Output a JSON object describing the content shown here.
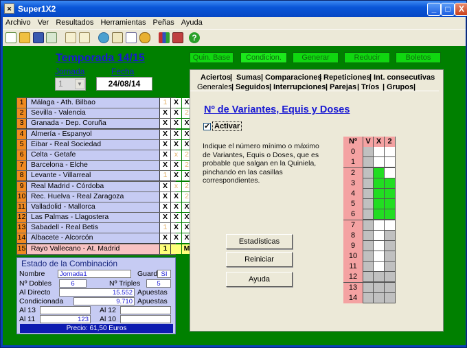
{
  "window": {
    "title": "Super1X2",
    "buttons": [
      "_",
      "□",
      "X"
    ]
  },
  "menu": [
    "Archivo",
    "Ver",
    "Resultados",
    "Herramientas",
    "Peñas",
    "Ayuda"
  ],
  "toolbar": {
    "icons": [
      "new-icon",
      "open-icon",
      "save-icon",
      "export-icon",
      "copy-icon",
      "paste-icon",
      "globe-icon",
      "edit-icon",
      "document-icon",
      "coins-icon",
      "chart-icon",
      "book-icon",
      "help-icon"
    ],
    "help_glyph": "?"
  },
  "season": {
    "title": "Temporada 14/15",
    "jornada_label": "Jornada",
    "jornada_value": "1",
    "fecha_label": "Fecha",
    "fecha_value": "24/08/14"
  },
  "matches": [
    {
      "n": "1",
      "name": "Málaga - Ath. Bilbao",
      "c1": "1",
      "c2": "X",
      "c3": "X"
    },
    {
      "n": "2",
      "name": "Sevilla - Valencia",
      "c1": "X",
      "c2": "X",
      "c3": "2"
    },
    {
      "n": "3",
      "name": "Granada - Dep. Coruña",
      "c1": "X",
      "c2": "X",
      "c3": "X"
    },
    {
      "n": "4",
      "name": "Almería - Espanyol",
      "c1": "X",
      "c2": "X",
      "c3": "X"
    },
    {
      "n": "5",
      "name": "Eibar - Real Sociedad",
      "c1": "X",
      "c2": "X",
      "c3": "X"
    },
    {
      "n": "6",
      "name": "Celta - Getafe",
      "c1": "X",
      "c2": "x",
      "c3": "2"
    },
    {
      "n": "7",
      "name": "Barcelona - Elche",
      "c1": "X",
      "c2": "X",
      "c3": "2"
    },
    {
      "n": "8",
      "name": "Levante - Villarreal",
      "c1": "1",
      "c2": "X",
      "c3": "X"
    },
    {
      "n": "9",
      "name": "Real Madrid - Córdoba",
      "c1": "X",
      "c2": "x",
      "c3": "2"
    },
    {
      "n": "10",
      "name": "Rec. Huelva - Real Zaragoza",
      "c1": "X",
      "c2": "X",
      "c3": "2"
    },
    {
      "n": "11",
      "name": "Valladolid - Mallorca",
      "c1": "X",
      "c2": "X",
      "c3": "X"
    },
    {
      "n": "12",
      "name": "Las Palmas - Llagostera",
      "c1": "X",
      "c2": "X",
      "c3": "X"
    },
    {
      "n": "13",
      "name": "Sabadell - Real Betis",
      "c1": "1",
      "c2": "X",
      "c3": "X"
    },
    {
      "n": "14",
      "name": "Albacete - Alcorcón",
      "c1": "X",
      "c2": "X",
      "c3": "X"
    },
    {
      "n": "15",
      "name": "Rayo Vallecano - At. Madrid",
      "c1": "1",
      "c2": "",
      "c3": "M"
    }
  ],
  "dim_cells": [
    [
      0,
      0
    ],
    [
      1,
      2
    ],
    [
      5,
      1
    ],
    [
      5,
      2
    ],
    [
      6,
      2
    ],
    [
      7,
      0
    ],
    [
      8,
      1
    ],
    [
      8,
      2
    ],
    [
      9,
      2
    ],
    [
      12,
      0
    ]
  ],
  "estado": {
    "title": "Estado de la Combinación",
    "nombre_label": "Nombre",
    "nombre_value": "Jornada1",
    "guardada_label": "Guardada",
    "guardada_value": "SI",
    "dobles_label": "Nº Dobles",
    "dobles_value": "6",
    "triples_label": "Nº Triples",
    "triples_value": "5",
    "directo_label": "Al Directo",
    "directo_value": "15.552",
    "apuestas1": "Apuestas",
    "condicionada_label": "Condicionada",
    "condicionada_value": "9.710",
    "apuestas2": "Apuestas",
    "al13_label": "Al 13",
    "al13_value": "",
    "al12_label": "Al 12",
    "al12_value": "",
    "al11_label": "Al 11",
    "al11_value": "123",
    "al10_label": "Al 10",
    "al10_value": "",
    "precio": "Precio: 61,50 Euros"
  },
  "top_buttons": [
    "Quin. Base",
    "Condicion.",
    "Generar",
    "Reducir",
    "Boletos"
  ],
  "tabs": {
    "row1": [
      "Aciertos",
      "Sumas",
      "Comparaciones",
      "Repeticiones",
      "Int. consecutivas"
    ],
    "row2": [
      "Generales",
      "Seguidos",
      "Interrupciones",
      "Parejas",
      "Tríos",
      "Grupos"
    ],
    "separator": "|"
  },
  "content": {
    "heading": "Nº de Variantes, Equis y Doses",
    "activar_label": "Activar",
    "checked_mark": "✔",
    "description": "Indique el número mínimo o máximo de Variantes, Equis o Doses, que es probable que salgan en la Quiniela, pinchando en las casillas correspondientes.",
    "buttons": [
      "Estadísticas",
      "Reiniciar",
      "Ayuda"
    ]
  },
  "grid": {
    "headers": [
      "Nº",
      "V",
      "X",
      "2"
    ],
    "rows": [
      "0",
      "1",
      "2",
      "3",
      "4",
      "5",
      "6",
      "7",
      "8",
      "9",
      "10",
      "11",
      "12",
      "13",
      "14"
    ],
    "colors": {
      "green": "#22dd22",
      "gray": "#c0c0c0",
      "white": "#ffffff"
    },
    "cells": [
      [
        "gray",
        "white",
        "white"
      ],
      [
        "gray",
        "white",
        "white"
      ],
      [
        "gray",
        "green",
        "white"
      ],
      [
        "gray",
        "green",
        "green"
      ],
      [
        "gray",
        "green",
        "green"
      ],
      [
        "gray",
        "green",
        "green"
      ],
      [
        "gray",
        "green",
        "green"
      ],
      [
        "gray",
        "white",
        "white"
      ],
      [
        "gray",
        "white",
        "gray"
      ],
      [
        "gray",
        "white",
        "gray"
      ],
      [
        "gray",
        "white",
        "gray"
      ],
      [
        "gray",
        "white",
        "gray"
      ],
      [
        "gray",
        "gray",
        "gray"
      ],
      [
        "gray",
        "gray",
        "gray"
      ],
      [
        "gray",
        "gray",
        "gray"
      ]
    ]
  }
}
